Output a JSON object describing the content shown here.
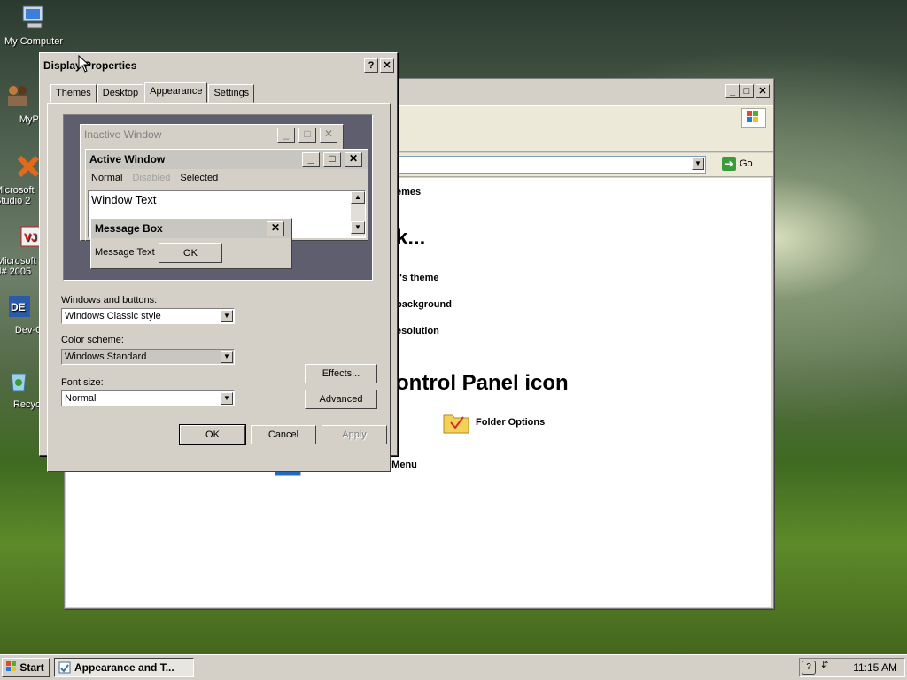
{
  "desktop": {
    "icons": [
      {
        "label": "My Computer"
      },
      {
        "label": "MyPa"
      },
      {
        "label": "Microsoft Studio 2"
      },
      {
        "label": "Microsoft J# 2005"
      },
      {
        "label": "Dev-C"
      },
      {
        "label": "Recycl"
      }
    ]
  },
  "control_panel": {
    "go_label": "Go",
    "tasks": [
      {
        "label": "emes"
      },
      {
        "label": "r's theme"
      },
      {
        "label": "background"
      },
      {
        "label": "esolution"
      }
    ],
    "pick_task_heading": "k...",
    "or_heading": "ontrol Panel icon",
    "icons": [
      {
        "label": "Folder Options"
      },
      {
        "label": "Taskbar and Start Menu"
      }
    ]
  },
  "dialog": {
    "title": "Display Properties",
    "help_glyph": "?",
    "close_glyph": "✕",
    "tabs": [
      "Themes",
      "Desktop",
      "Appearance",
      "Settings"
    ],
    "preview": {
      "inactive_title": "Inactive Window",
      "active_title": "Active Window",
      "menu": [
        "Normal",
        "Disabled",
        "Selected"
      ],
      "window_text": "Window Text",
      "message_box_title": "Message Box",
      "message_text": "Message Text",
      "ok": "OK"
    },
    "windows_buttons_label": "Windows and buttons:",
    "windows_buttons_value": "Windows Classic style",
    "color_scheme_label": "Color scheme:",
    "color_scheme_value": "Windows Standard",
    "font_size_label": "Font size:",
    "font_size_value": "Normal",
    "effects_button": "Effects...",
    "advanced_button": "Advanced",
    "ok_button": "OK",
    "cancel_button": "Cancel",
    "apply_button": "Apply"
  },
  "taskbar": {
    "start_label": "Start",
    "task_label": "Appearance and T...",
    "clock": "11:15 AM"
  }
}
